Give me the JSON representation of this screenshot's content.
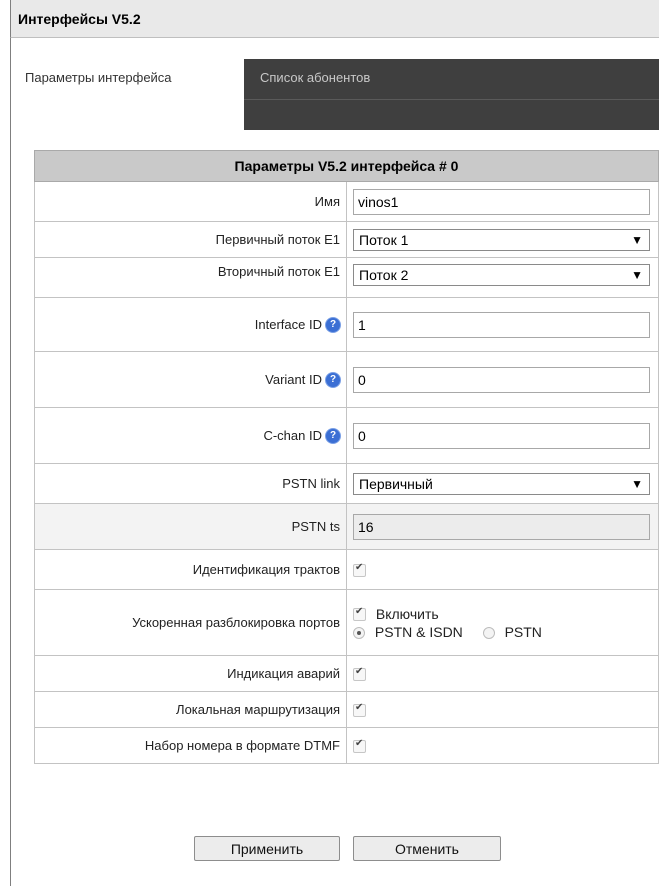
{
  "window": {
    "title": "Интерфейсы V5.2"
  },
  "tabs": [
    {
      "label": "Параметры интерфейса",
      "active": true
    },
    {
      "label": "Список абонентов",
      "active": false
    }
  ],
  "form": {
    "header": "Параметры V5.2 интерфейса # 0",
    "name": {
      "label": "Имя",
      "value": "vinos1"
    },
    "primary_stream": {
      "label": "Первичный поток E1",
      "value": "Поток 1"
    },
    "secondary_stream": {
      "label": "Вторичный поток E1",
      "value": "Поток 2"
    },
    "interface_id": {
      "label": "Interface ID",
      "value": "1"
    },
    "variant_id": {
      "label": "Variant ID",
      "value": "0"
    },
    "c_chan_id": {
      "label": "C-chan ID",
      "value": "0"
    },
    "pstn_link": {
      "label": "PSTN link",
      "value": "Первичный"
    },
    "pstn_ts": {
      "label": "PSTN ts",
      "value": "16"
    },
    "path_identification": {
      "label": "Идентификация трактов",
      "checked": true
    },
    "fast_unblock": {
      "label": "Ускоренная разблокировка портов",
      "enable_label": "Включить",
      "enable_checked": true,
      "options": [
        "PSTN & ISDN",
        "PSTN"
      ],
      "selected": "PSTN & ISDN"
    },
    "alarm_indication": {
      "label": "Индикация аварий",
      "checked": true
    },
    "local_routing": {
      "label": "Локальная маршрутизация",
      "checked": true
    },
    "dtmf_dialing": {
      "label": "Набор номера в формате DTMF",
      "checked": true
    }
  },
  "buttons": {
    "apply": "Применить",
    "cancel": "Отменить"
  },
  "icons": {
    "help": "help-icon",
    "dropdown": "chevron-down-icon",
    "check": "checkmark-icon"
  },
  "colors": {
    "title_bar": "#e9e9e9",
    "tab_strip": "#3f3f3f",
    "table_header": "#c9c9c9",
    "help_icon": "#3b6fd4"
  }
}
